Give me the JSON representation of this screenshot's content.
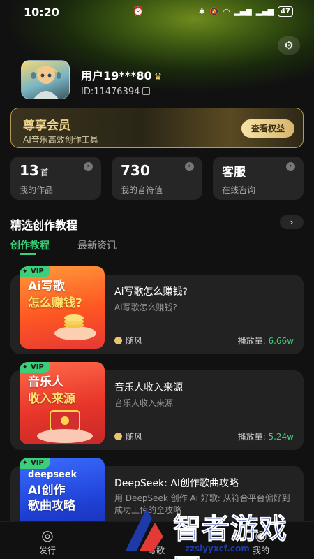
{
  "status_bar": {
    "time": "10:20",
    "battery": "47"
  },
  "profile": {
    "name": "用户19***80",
    "id": "ID:11476394"
  },
  "vip": {
    "title": "尊享会员",
    "subtitle": "AI音乐高效创作工具",
    "button": "查看权益"
  },
  "stats": [
    {
      "value": "13",
      "unit": "首",
      "label": "我的作品"
    },
    {
      "value": "730",
      "unit": "",
      "label": "我的音符值"
    },
    {
      "value": "客服",
      "unit": "",
      "label": "在线咨询"
    }
  ],
  "section": {
    "title": "精选创作教程",
    "more": "›"
  },
  "tabs": [
    {
      "label": "创作教程"
    },
    {
      "label": "最新资讯"
    }
  ],
  "cards": [
    {
      "badge": "VIP",
      "thumb_line1": "Ai写歌",
      "thumb_line2": "怎么赚钱?",
      "title": "Ai写歌怎么赚钱?",
      "subtitle": "Ai写歌怎么赚钱?",
      "author": "随风",
      "plays_label": "播放量:",
      "plays": "6.66w"
    },
    {
      "badge": "VIP",
      "thumb_line1": "音乐人",
      "thumb_line2": "收入来源",
      "title": "音乐人收入来源",
      "subtitle": "音乐人收入来源",
      "author": "随风",
      "plays_label": "播放量:",
      "plays": "5.24w"
    },
    {
      "badge": "VIP",
      "thumb_brand": "deepseek",
      "thumb_line1": "AI创作",
      "thumb_line2": "歌曲攻略",
      "title": "DeepSeek: AI创作歌曲攻略",
      "subtitle": "用 DeepSeek 创作 Ai 好歌: 从符合平台偏好到成功上传的全攻略"
    }
  ],
  "tabbar": [
    {
      "label": "发行",
      "icon": "camera-icon"
    },
    {
      "label": "写歌",
      "icon": "music-icon"
    },
    {
      "label": "我的",
      "icon": "user-icon"
    }
  ],
  "watermark": {
    "text": "智者游戏网",
    "url": "zzslyyxcf.com"
  },
  "colors": {
    "accent": "#3ad07a",
    "gold": "#f1d58c",
    "background": "#111111",
    "card": "#222222"
  }
}
